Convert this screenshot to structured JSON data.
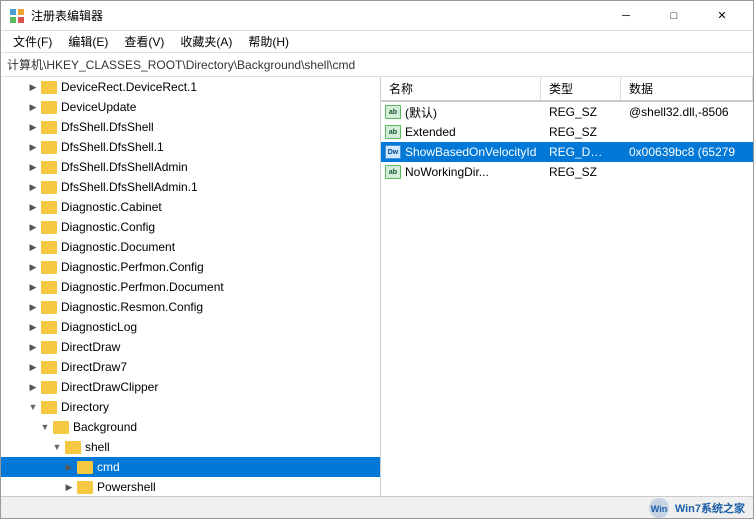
{
  "window": {
    "title": "注册表编辑器",
    "address": "计算机\\HKEY_CLASSES_ROOT\\Directory\\Background\\shell\\cmd"
  },
  "menu": {
    "items": [
      "文件(F)",
      "编辑(E)",
      "查看(V)",
      "收藏夹(A)",
      "帮助(H)"
    ]
  },
  "titlebar": {
    "minimize": "─",
    "maximize": "□",
    "close": "✕"
  },
  "tree": {
    "items": [
      {
        "label": "DeviceRect.DeviceRect.1",
        "indent": 2,
        "arrow": "▶",
        "level": 1,
        "expanded": false
      },
      {
        "label": "DeviceUpdate",
        "indent": 2,
        "arrow": "▶",
        "level": 1,
        "expanded": false
      },
      {
        "label": "DfsShell.DfsShell",
        "indent": 2,
        "arrow": "▶",
        "level": 1,
        "expanded": false
      },
      {
        "label": "DfsShell.DfsShell.1",
        "indent": 2,
        "arrow": "▶",
        "level": 1,
        "expanded": false
      },
      {
        "label": "DfsShell.DfsShellAdmin",
        "indent": 2,
        "arrow": "▶",
        "level": 1,
        "expanded": false
      },
      {
        "label": "DfsShell.DfsShellAdmin.1",
        "indent": 2,
        "arrow": "▶",
        "level": 1,
        "expanded": false
      },
      {
        "label": "Diagnostic.Cabinet",
        "indent": 2,
        "arrow": "▶",
        "level": 1,
        "expanded": false
      },
      {
        "label": "Diagnostic.Config",
        "indent": 2,
        "arrow": "▶",
        "level": 1,
        "expanded": false
      },
      {
        "label": "Diagnostic.Document",
        "indent": 2,
        "arrow": "▶",
        "level": 1,
        "expanded": false
      },
      {
        "label": "Diagnostic.Perfmon.Config",
        "indent": 2,
        "arrow": "▶",
        "level": 1,
        "expanded": false
      },
      {
        "label": "Diagnostic.Perfmon.Document",
        "indent": 2,
        "arrow": "▶",
        "level": 1,
        "expanded": false
      },
      {
        "label": "Diagnostic.Resmon.Config",
        "indent": 2,
        "arrow": "▶",
        "level": 1,
        "expanded": false
      },
      {
        "label": "DiagnosticLog",
        "indent": 2,
        "arrow": "▶",
        "level": 1,
        "expanded": false
      },
      {
        "label": "DirectDraw",
        "indent": 2,
        "arrow": "▶",
        "level": 1,
        "expanded": false
      },
      {
        "label": "DirectDraw7",
        "indent": 2,
        "arrow": "▶",
        "level": 1,
        "expanded": false
      },
      {
        "label": "DirectDrawClipper",
        "indent": 2,
        "arrow": "▶",
        "level": 1,
        "expanded": false
      },
      {
        "label": "Directory",
        "indent": 2,
        "arrow": "▼",
        "level": 1,
        "expanded": true
      },
      {
        "label": "Background",
        "indent": 3,
        "arrow": "▼",
        "level": 2,
        "expanded": true
      },
      {
        "label": "shell",
        "indent": 4,
        "arrow": "▼",
        "level": 3,
        "expanded": true
      },
      {
        "label": "cmd",
        "indent": 5,
        "arrow": "▶",
        "level": 4,
        "expanded": false,
        "selected": true
      },
      {
        "label": "Powershell",
        "indent": 5,
        "arrow": "▶",
        "level": 4,
        "expanded": false
      }
    ]
  },
  "values": {
    "headers": [
      "名称",
      "类型",
      "数据"
    ],
    "rows": [
      {
        "name": "(默认)",
        "type": "REG_SZ",
        "data": "@shell32.dll,-8506",
        "iconType": "ab",
        "selected": false
      },
      {
        "name": "Extended",
        "type": "REG_SZ",
        "data": "",
        "iconType": "ab",
        "selected": false
      },
      {
        "name": "ShowBasedOnVelocityId",
        "type": "REG_DWORD",
        "data": "0x00639bc8 (65279",
        "iconType": "dword",
        "selected": true
      },
      {
        "name": "NoWorkingDir...",
        "type": "REG_SZ",
        "data": "",
        "iconType": "ab",
        "selected": false
      }
    ]
  },
  "statusbar": {
    "watermark": "Win7系统之家"
  }
}
